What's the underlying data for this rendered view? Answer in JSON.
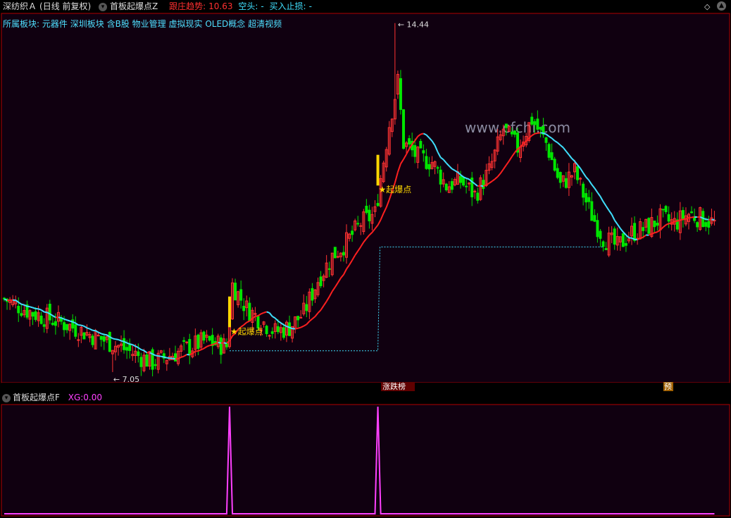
{
  "header": {
    "stock_name": "深纺织Ａ",
    "period": "(日线 前复权)",
    "indicator_main": "首板起爆点Z",
    "trend_label": "跟庄趋势:",
    "trend_value": "10.63",
    "short_label": "空头:",
    "short_value": "-",
    "stop_label": "买入止损:",
    "stop_value": "-"
  },
  "sectors": {
    "label": "所属板块:",
    "items": [
      "元器件",
      "深圳板块",
      "含B股",
      "物业管理",
      "虚拟现实",
      "OLED概念",
      "超清视频"
    ]
  },
  "watermark": "www.cfchi.com",
  "annotations": {
    "high_label": "14.44",
    "low_label": "7.05",
    "signal_label": "★起爆点",
    "event_tag_1": "涨跌榜",
    "event_tag_2": "预"
  },
  "sub_panel": {
    "title": "首板起爆点F",
    "xg_label": "XG:",
    "xg_value": "0.00"
  },
  "colors": {
    "up": "#ff3232",
    "down": "#00e600",
    "ma_rising": "#ff2020",
    "ma_falling": "#40e0ff",
    "signal": "#ffd700",
    "indicator": "#ff40ff",
    "panel_bg": "#100010"
  },
  "chart_data": {
    "type": "candlestick",
    "price_extremes": {
      "high": 14.44,
      "low": 7.05
    },
    "signal_bar_indices": [
      79,
      131
    ],
    "indicator_values": "0 except 1 at the two signal bars"
  }
}
